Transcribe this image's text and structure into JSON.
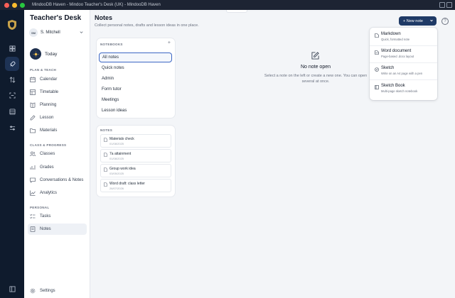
{
  "window": {
    "title": "MindooDB Haven - Mindoo Teacher's Desk (UK) - MindooDB Haven"
  },
  "app": {
    "brand": "Teacher's Desk"
  },
  "user": {
    "initials": "SM",
    "name": "S. Mitchell"
  },
  "sidebar": {
    "today_label": "Today",
    "sections": {
      "plan_teach": "PLAN & TEACH",
      "class_progress": "CLASS & PROGRESS",
      "personal": "PERSONAL"
    },
    "items": [
      {
        "label": "Calendar",
        "icon": "calendar-icon"
      },
      {
        "label": "Timetable",
        "icon": "table-icon"
      },
      {
        "label": "Planning",
        "icon": "book-icon"
      },
      {
        "label": "Lesson",
        "icon": "edit-icon"
      },
      {
        "label": "Materials",
        "icon": "folder-icon"
      },
      {
        "label": "Classes",
        "icon": "users-icon"
      },
      {
        "label": "Grades",
        "icon": "chart-icon"
      },
      {
        "label": "Conversations & Notes",
        "icon": "chat-icon"
      },
      {
        "label": "Analytics",
        "icon": "trend-icon"
      },
      {
        "label": "Tasks",
        "icon": "list-icon"
      },
      {
        "label": "Notes",
        "icon": "note-icon",
        "active": true
      }
    ],
    "settings_label": "Settings"
  },
  "main": {
    "title": "Notes",
    "subtitle": "Collect personal notes, drafts and lesson ideas in one place.",
    "new_note_label": "+ New note",
    "help_label": "?"
  },
  "notebooks": {
    "header": "NOTEBOOKS",
    "add_label": "+",
    "items": [
      "All notes",
      "Quick notes",
      "Admin",
      "Form tutor",
      "Meetings",
      "Lesson ideas"
    ],
    "selected_index": 0
  },
  "notes": {
    "header": "NOTES",
    "items": [
      {
        "title": "Materials check",
        "date": "01/08/2025"
      },
      {
        "title": "7a attainment",
        "date": "01/08/2025"
      },
      {
        "title": "Group work idea",
        "date": "03/05/2025"
      },
      {
        "title": "Word draft: class letter",
        "date": "26/07/2026"
      }
    ]
  },
  "empty_state": {
    "title": "No note open",
    "description": "Select a note on the left or create a new one. You can open several at once."
  },
  "new_note_menu": [
    {
      "label": "Markdown",
      "desc": "Quick, formatted note"
    },
    {
      "label": "Word document",
      "desc": "Page-based .docx layout"
    },
    {
      "label": "Sketch",
      "desc": "Write on an A4 page with a pen"
    },
    {
      "label": "Sketch Book",
      "desc": "Multi-page sketch notebook"
    }
  ],
  "colors": {
    "rail_bg": "#0f1b2d",
    "accent": "#1f3a66",
    "selection_border": "#3b66c4",
    "main_bg": "#f3f5f8"
  }
}
